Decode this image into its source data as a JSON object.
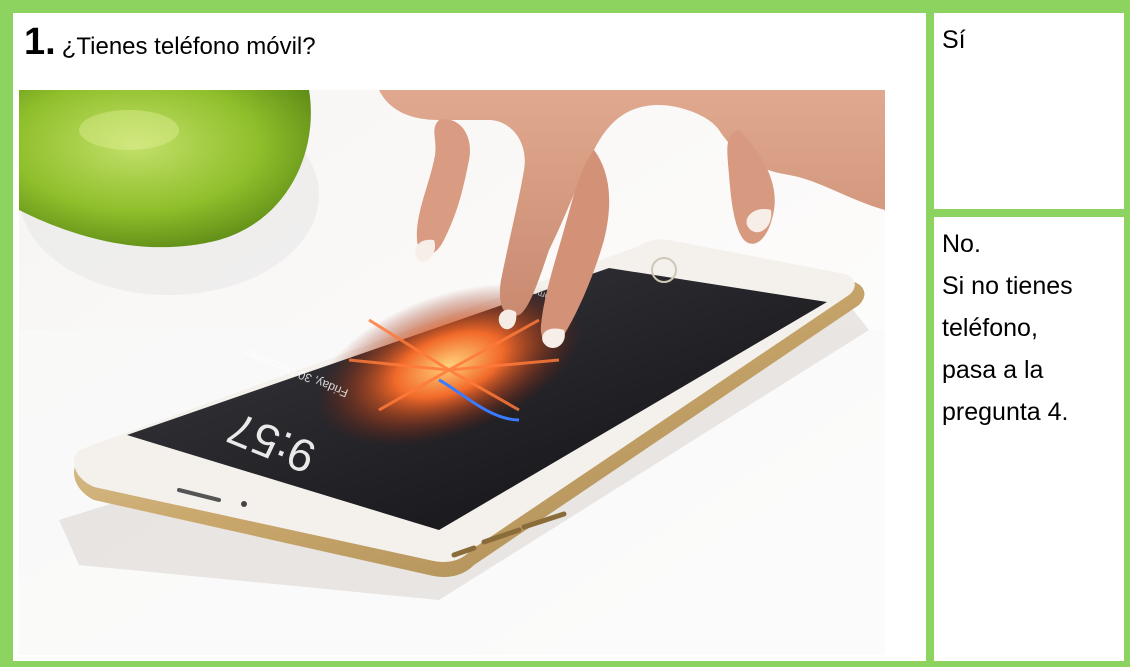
{
  "question": {
    "number": "1.",
    "text": "¿Tienes teléfono móvil?"
  },
  "options": {
    "yes": {
      "label": "Sí"
    },
    "no": {
      "lines": [
        "No.",
        "Si no tienes",
        "teléfono,",
        "pasa a la",
        "pregunta 4."
      ]
    }
  },
  "photo": {
    "subject": "hand-touching-smartphone",
    "screen_text": {
      "time": "9:57",
      "date": "Friday, 30 December",
      "header": "Press home to unlock"
    }
  },
  "colors": {
    "border": "#8dd35f",
    "background": "#ffffff",
    "text": "#000000"
  }
}
